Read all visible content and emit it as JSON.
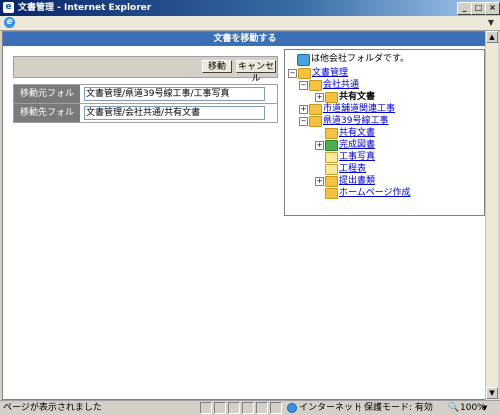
{
  "window": {
    "title": "文書管理 - Internet Explorer",
    "title_icon": "ie-document-icon",
    "controls": [
      "minimize",
      "maximize",
      "close"
    ]
  },
  "header": {
    "title": "文書を移動する"
  },
  "form": {
    "move_button": "移動",
    "cancel_button": "キャンセル",
    "source_label": "移動元フォルダ",
    "source_value": "文書管理/県道39号線工事/工事写真",
    "dest_label": "移動先フォルダ",
    "dest_value": "文書管理/会社共通/共有文書"
  },
  "tree": {
    "other_company_label": "は他会社フォルダです。",
    "nodes": [
      {
        "label": "文書管理",
        "expander": "−",
        "icon": "folder"
      },
      {
        "label": "会社共通",
        "expander": "−",
        "icon": "folder"
      },
      {
        "label": "共有文書",
        "expander": "+",
        "icon": "folder-open"
      },
      {
        "label": "市道舗道関連工事",
        "expander": "+",
        "icon": "folder"
      },
      {
        "label": "県道39号線工事",
        "expander": "−",
        "icon": "folder"
      },
      {
        "label": "共有文書",
        "expander": "",
        "icon": "folder"
      },
      {
        "label": "完成図書",
        "expander": "+",
        "icon": "folder-green"
      },
      {
        "label": "工事写真",
        "expander": "",
        "icon": "folder-doc"
      },
      {
        "label": "工程表",
        "expander": "",
        "icon": "folder-doc"
      },
      {
        "label": "提出書類",
        "expander": "+",
        "icon": "folder"
      },
      {
        "label": "ホームページ作成",
        "expander": "",
        "icon": "folder"
      }
    ]
  },
  "status": {
    "text": "ページが表示されました",
    "zone": "インターネット",
    "protected_mode": "保護モード: 有効",
    "zoom": "100%"
  }
}
